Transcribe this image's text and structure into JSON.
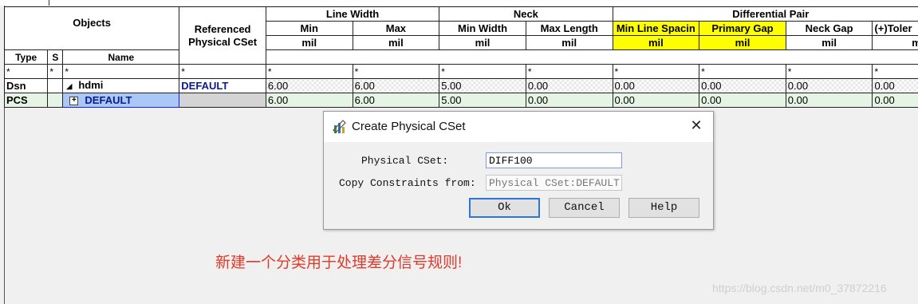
{
  "table": {
    "group_headers": {
      "objects": "Objects",
      "referenced": "Referenced Physical CSet",
      "line_width": "Line Width",
      "neck": "Neck",
      "diff_pair": "Differential Pair"
    },
    "sub_headers": {
      "min": "Min",
      "max": "Max",
      "min_width": "Min Width",
      "max_length": "Max Length",
      "min_line_spacing": "Min Line Spacin",
      "primary_gap": "Primary Gap",
      "neck_gap": "Neck Gap",
      "tolerance": "(+)Toler"
    },
    "col_headers": {
      "type": "Type",
      "s": "S",
      "name": "Name"
    },
    "unit": "mil",
    "filter": "*",
    "rows": [
      {
        "type": "Dsn",
        "s": "",
        "name": "hdmi",
        "ref": "DEFAULT",
        "lw_min": "6.00",
        "lw_max": "6.00",
        "neck_min_width": "5.00",
        "neck_max_length": "0.00",
        "min_line_spacing": "0.00",
        "primary_gap": "0.00",
        "neck_gap": "0.00",
        "tolerance": "0.00"
      },
      {
        "type": "PCS",
        "s": "",
        "name": "DEFAULT",
        "ref": "",
        "lw_min": "6.00",
        "lw_max": "6.00",
        "neck_min_width": "5.00",
        "neck_max_length": "0.00",
        "min_line_spacing": "0.00",
        "primary_gap": "0.00",
        "neck_gap": "0.00",
        "tolerance": "0.00"
      }
    ]
  },
  "dialog": {
    "title": "Create Physical CSet",
    "physical_cset_label": "Physical CSet:",
    "physical_cset_value": "DIFF100",
    "copy_from_label": "Copy Constraints from:",
    "copy_from_value": "Physical CSet:DEFAULT",
    "ok_label": "Ok",
    "cancel_label": "Cancel",
    "help_label": "Help"
  },
  "annotation": "新建一个分类用于处理差分信号规则!",
  "watermark": "https://blog.csdn.net/m0_37872216",
  "colors": {
    "highlight_yellow": "#ffff00",
    "selected_row": "#a9c8f5",
    "pcs_row": "#e6f4e6",
    "note_red": "#e03a2a"
  },
  "icons": [
    "create-cset-icon",
    "close-icon",
    "collapse-triangle-icon",
    "expand-plus-icon"
  ]
}
